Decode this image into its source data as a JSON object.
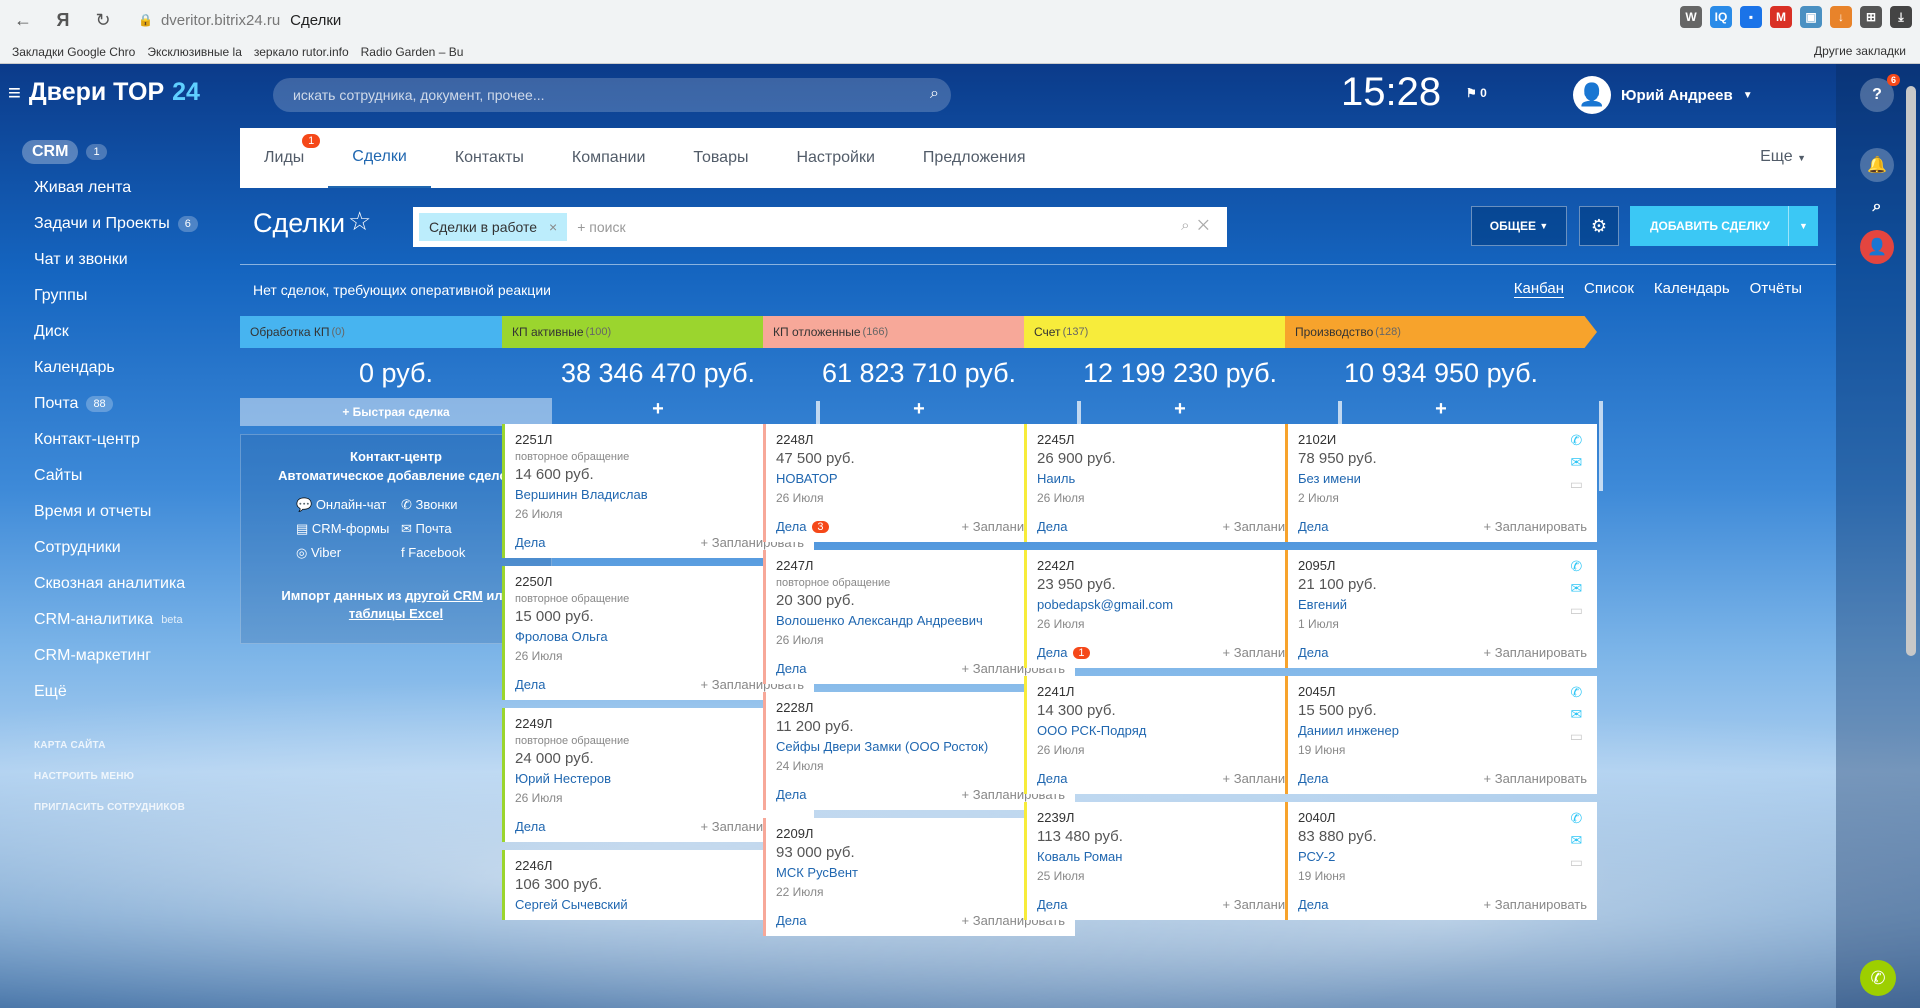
{
  "browser": {
    "url_host": "dveritor.bitrix24.ru",
    "tab_title": "Сделки",
    "bookmarks": [
      "Закладки Google Chro",
      "Эксклюзивные la",
      "зеркало rutor.info",
      "Radio Garden – Bu"
    ],
    "other_bookmarks": "Другие закладки"
  },
  "app": {
    "logo": "Двери TOP",
    "logo_num": "24",
    "search_placeholder": "искать сотрудника, документ, прочее...",
    "clock": "15:28",
    "flag_count": "0",
    "user_name": "Юрий Андреев",
    "help_badge": "6"
  },
  "sidebar": {
    "crm": "CRM",
    "crm_count": "1",
    "items": [
      {
        "label": "Живая лента",
        "count": ""
      },
      {
        "label": "Задачи и Проекты",
        "count": "6"
      },
      {
        "label": "Чат и звонки",
        "count": ""
      },
      {
        "label": "Группы",
        "count": ""
      },
      {
        "label": "Диск",
        "count": ""
      },
      {
        "label": "Календарь",
        "count": ""
      },
      {
        "label": "Почта",
        "count": "88"
      },
      {
        "label": "Контакт-центр",
        "count": ""
      },
      {
        "label": "Сайты",
        "count": ""
      },
      {
        "label": "Время и отчеты",
        "count": ""
      },
      {
        "label": "Сотрудники",
        "count": ""
      },
      {
        "label": "Сквозная аналитика",
        "count": ""
      },
      {
        "label": "CRM-аналитика",
        "count": ""
      },
      {
        "label": "CRM-маркетинг",
        "count": ""
      },
      {
        "label": "Ещё",
        "count": ""
      }
    ],
    "beta": "beta",
    "small_links": [
      "КАРТА САЙТА",
      "НАСТРОИТЬ МЕНЮ",
      "ПРИГЛАСИТЬ СОТРУДНИКОВ"
    ]
  },
  "tabs": {
    "items": [
      "Лиды",
      "Сделки",
      "Контакты",
      "Компании",
      "Товары",
      "Настройки",
      "Предложения"
    ],
    "leads_badge": "1",
    "more": "Еще"
  },
  "toolbar": {
    "title": "Сделки",
    "filter_tag": "Сделки в работе",
    "filter_placeholder": "+ поиск",
    "general": "ОБЩЕЕ",
    "add": "ДОБАВИТЬ СДЕЛКУ"
  },
  "info": {
    "no_deals": "Нет сделок, требующих оперативной реакции",
    "views": [
      "Канбан",
      "Список",
      "Календарь",
      "Отчёты"
    ]
  },
  "contact_center": {
    "title": "Контакт-центр",
    "subtitle": "Автоматическое добавление сделок",
    "items": [
      "Онлайн-чат",
      "Звонки",
      "CRM-формы",
      "Почта",
      "Viber",
      "Facebook"
    ],
    "import_text": "Импорт данных из",
    "import_link1": "другой CRM",
    "import_or": "или",
    "import_link2": "таблицы Excel"
  },
  "quick_deal": "+ Быстрая сделка",
  "plan_label": "+ Запланировать",
  "tasks_label": "Дела",
  "columns": [
    {
      "name": "Обработка КП",
      "count": "(0)",
      "sum": "0 руб.",
      "color": "#47b4f0",
      "cards": []
    },
    {
      "name": "КП активные",
      "count": "(100)",
      "sum": "38 346 470 руб.",
      "color": "#9bd52e",
      "cards": [
        {
          "id": "2251Л",
          "sub": "повторное обращение",
          "price": "14 600 руб.",
          "client": "Вершинин Владислав",
          "date": "26 Июля",
          "badge": ""
        },
        {
          "id": "2250Л",
          "sub": "повторное обращение",
          "price": "15 000 руб.",
          "client": "Фролова Ольга",
          "date": "26 Июля",
          "badge": ""
        },
        {
          "id": "2249Л",
          "sub": "повторное обращение",
          "price": "24 000 руб.",
          "client": "Юрий Нестеров",
          "date": "26 Июля",
          "badge": ""
        },
        {
          "id": "2246Л",
          "sub": "",
          "price": "106 300 руб.",
          "client": "Сергей Сычевский",
          "date": "",
          "badge": ""
        }
      ]
    },
    {
      "name": "КП отложенные",
      "count": "(166)",
      "sum": "61 823 710 руб.",
      "color": "#f7a899",
      "cards": [
        {
          "id": "2248Л",
          "sub": "",
          "price": "47 500 руб.",
          "client": "НОВАТОР",
          "date": "26 Июля",
          "badge": "3"
        },
        {
          "id": "2247Л",
          "sub": "повторное обращение",
          "price": "20 300 руб.",
          "client": "Волошенко Александр Андреевич",
          "date": "26 Июля",
          "badge": ""
        },
        {
          "id": "2228Л",
          "sub": "",
          "price": "11 200 руб.",
          "client": "Сейфы Двери Замки (ООО Росток)",
          "date": "24 Июля",
          "badge": ""
        },
        {
          "id": "2209Л",
          "sub": "",
          "price": "93 000 руб.",
          "client": "МСК РусВент",
          "date": "22 Июля",
          "badge": ""
        }
      ]
    },
    {
      "name": "Счет",
      "count": "(137)",
      "sum": "12 199 230 руб.",
      "color": "#f7ec3b",
      "cards": [
        {
          "id": "2245Л",
          "sub": "",
          "price": "26 900 руб.",
          "client": "Наиль",
          "date": "26 Июля",
          "badge": ""
        },
        {
          "id": "2242Л",
          "sub": "",
          "price": "23 950 руб.",
          "client": "pobedapsk@gmail.com",
          "date": "26 Июля",
          "badge": "1"
        },
        {
          "id": "2241Л",
          "sub": "",
          "price": "14 300 руб.",
          "client": "ООО РСК-Подряд",
          "date": "26 Июля",
          "badge": ""
        },
        {
          "id": "2239Л",
          "sub": "",
          "price": "113 480 руб.",
          "client": "Коваль Роман",
          "date": "25 Июля",
          "badge": ""
        }
      ]
    },
    {
      "name": "Производство",
      "count": "(128)",
      "sum": "10 934 950 руб.",
      "color": "#f7a32c",
      "cards": [
        {
          "id": "2102И",
          "sub": "",
          "price": "78 950 руб.",
          "client": "Без имени",
          "date": "2 Июля",
          "badge": ""
        },
        {
          "id": "2095Л",
          "sub": "",
          "price": "21 100 руб.",
          "client": "Евгений",
          "date": "1 Июля",
          "badge": ""
        },
        {
          "id": "2045Л",
          "sub": "",
          "price": "15 500 руб.",
          "client": "Даниил инженер",
          "date": "19 Июня",
          "badge": ""
        },
        {
          "id": "2040Л",
          "sub": "",
          "price": "83 880 руб.",
          "client": "РСУ-2",
          "date": "19 Июня",
          "badge": ""
        }
      ]
    }
  ]
}
